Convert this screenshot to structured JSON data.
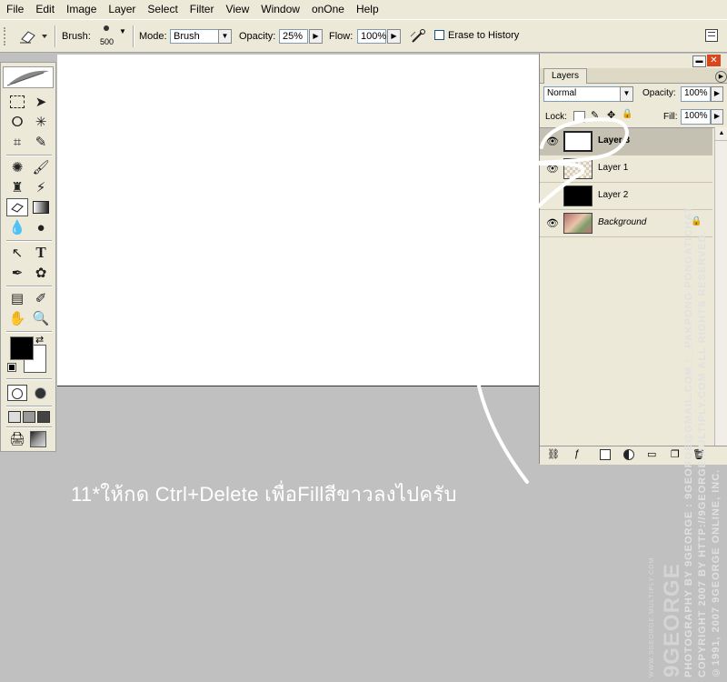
{
  "menu": [
    "File",
    "Edit",
    "Image",
    "Layer",
    "Select",
    "Filter",
    "View",
    "Window",
    "onOne",
    "Help"
  ],
  "options": {
    "brush_label": "Brush:",
    "brush_size": "500",
    "mode_label": "Mode:",
    "mode_value": "Brush",
    "opacity_label": "Opacity:",
    "opacity_value": "25%",
    "flow_label": "Flow:",
    "flow_value": "100%",
    "erase_history": "Erase to History"
  },
  "layers_panel": {
    "tab": "Layers",
    "blend_mode": "Normal",
    "opacity_label": "Opacity:",
    "opacity_value": "100%",
    "lock_label": "Lock:",
    "fill_label": "Fill:",
    "fill_value": "100%",
    "layers": [
      "Layer 3",
      "Layer 1",
      "Layer 2",
      "Background"
    ]
  },
  "caption": "11*ให้กด Ctrl+Delete เพื่อFillสีขาวลงไปครับ",
  "watermark": {
    "line1": "PHOTOGRAPHY BY 9GEORGE : 9GEORGE@GMAIL.COM : _PAKPONG PONGATICHAT",
    "line2": "COPYRIGHT 2007 BY HTTP://9GEORGE.MULTIPLY.COM ALL RIGHTS RESERVED.",
    "line3": "©1991, 2007 9GEORGE ONLINE, INC.",
    "logo": "9GEORGE",
    "url": "WWW.9GEORGE.MULTIPLY.COM"
  },
  "colors": {
    "fg": "#000000",
    "bg": "#ffffff",
    "chrome": "#ece9d8",
    "workspace": "#c0c0c0"
  }
}
